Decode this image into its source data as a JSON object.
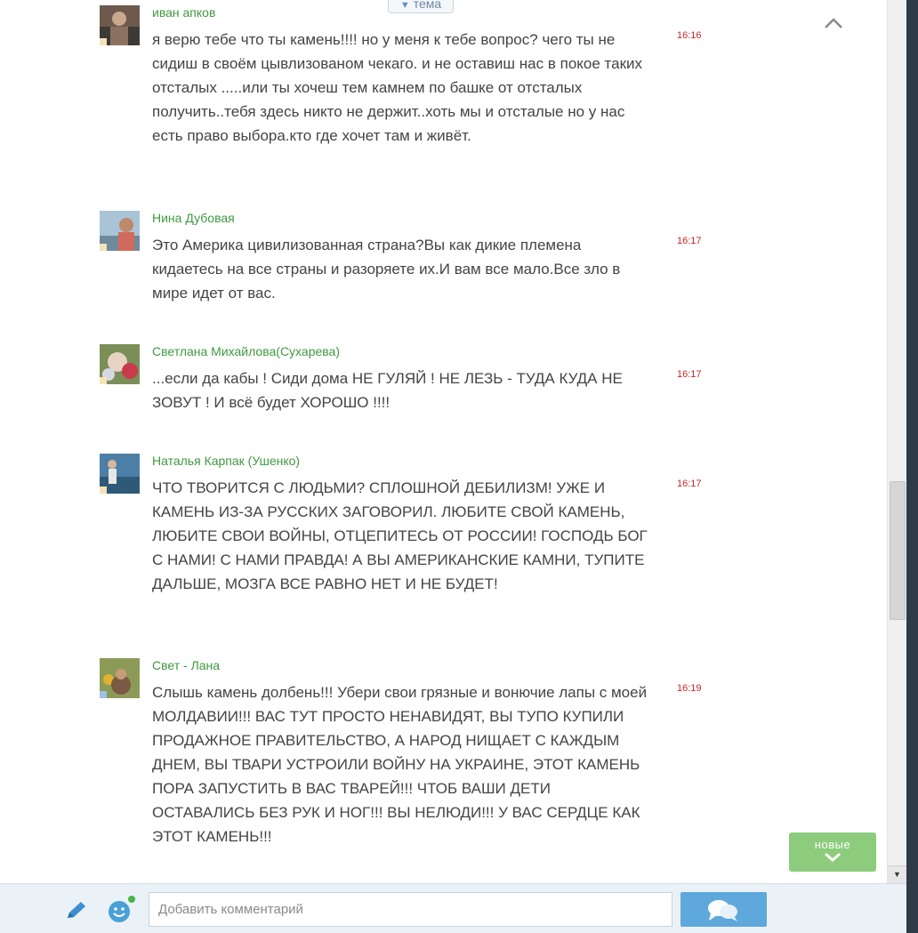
{
  "topic_tab": {
    "label": "тема",
    "arrow_icon": "triangle-down-icon"
  },
  "collapse": {
    "icon": "chevron-up-icon"
  },
  "comments": [
    {
      "author": "иван апков",
      "time": "16:16",
      "text": "я верю тебе что ты камень!!!! но у меня к тебе вопрос? чего ты не сидиш  в своём цывлизованом чекаго. и не оставиш нас в покое таких отсталых .....или ты хочеш  тем камнем по башке от отсталых получить..тебя здесь никто не держит..хоть мы и отсталые но у нас есть право выбора.кто где хочет там и живёт."
    },
    {
      "author": "Нина Дубовая",
      "time": "16:17",
      "text": "Это Америка цивилизованная страна?Вы как дикие племена кидаетесь на все страны и разоряете их.И вам все мало.Все зло в мире идет от вас."
    },
    {
      "author": "Светлана Михайлова(Сухарева)",
      "time": "16:17",
      "text": "...если да кабы ! Сиди дома НЕ ГУЛЯЙ ! НЕ ЛЕЗЬ - ТУДА КУДА НЕ ЗОВУТ ! И всё будет ХОРОШО !!!!"
    },
    {
      "author": "Наталья Карпак (Ушенко)",
      "time": "16:17",
      "text": "ЧТО ТВОРИТСЯ С ЛЮДЬМИ? СПЛОШНОЙ ДЕБИЛИЗМ! УЖЕ И КАМЕНЬ ИЗ-ЗА РУССКИХ ЗАГОВОРИЛ. ЛЮБИТЕ СВОЙ КАМЕНЬ, ЛЮБИТЕ СВОИ ВОЙНЫ, ОТЦЕПИТЕСЬ ОТ РОССИИ! ГОСПОДЬ БОГ С НАМИ! С НАМИ ПРАВДА! А ВЫ АМЕРИКАНСКИЕ КАМНИ, ТУПИТЕ ДАЛЬШЕ, МОЗГА ВСЕ РАВНО НЕТ И НЕ БУДЕТ!"
    },
    {
      "author": "Свет - Лана",
      "time": "16:19",
      "text": "Слышь камень долбень!!! Убери свои грязные и вонючие лапы с моей МОЛДАВИИ!!! ВАС ТУТ ПРОСТО НЕНАВИДЯТ, ВЫ ТУПО КУПИЛИ ПРОДАЖНОЕ ПРАВИТЕЛЬСТВО, А НАРОД НИЩАЕТ С КАЖДЫМ ДНЕМ, ВЫ ТВАРИ УСТРОИЛИ ВОЙНУ НА УКРАИНЕ, ЭТОТ КАМЕНЬ ПОРА ЗАПУСТИТЬ В ВАС ТВАРЕЙ!!! ЧТОБ ВАШИ ДЕТИ ОСТАВАЛИСЬ БЕЗ РУК И НОГ!!! ВЫ НЕЛЮДИ!!! У ВАС СЕРДЦЕ КАК ЭТОТ КАМЕНЬ!!!"
    }
  ],
  "new_button": {
    "label": "новые",
    "icon": "chevron-down-icon"
  },
  "composer": {
    "pencil_icon": "pencil-icon",
    "smiley_icon": "smiley-icon",
    "placeholder": "Добавить комментарий",
    "send_icon": "chat-bubbles-icon"
  },
  "colors": {
    "author": "#3f9a3f",
    "time": "#d12525",
    "accent": "#5fa8dc",
    "new_button": "#8ccc7c"
  }
}
